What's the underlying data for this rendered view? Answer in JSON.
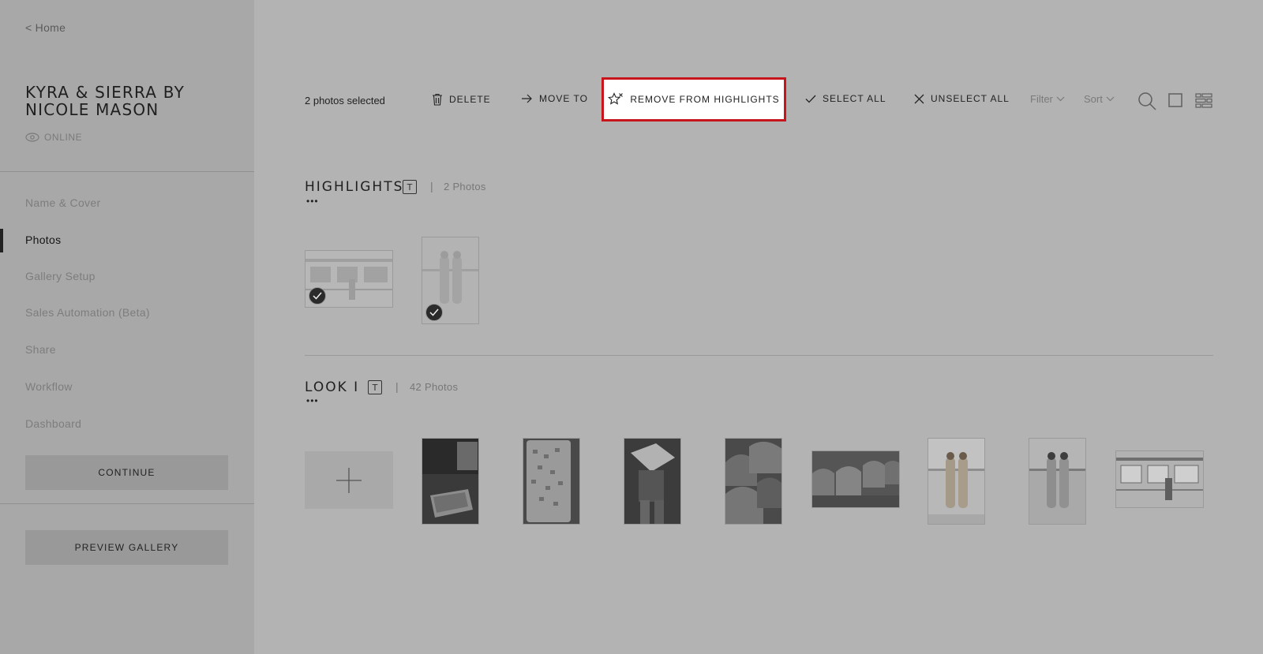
{
  "sidebar": {
    "home_link": "< Home",
    "gallery_title": "KYRA & SIERRA BY NICOLE MASON",
    "status": "ONLINE",
    "nav": [
      {
        "label": "Name & Cover"
      },
      {
        "label": "Photos"
      },
      {
        "label": "Gallery Setup"
      },
      {
        "label": "Sales Automation (Beta)"
      },
      {
        "label": "Share"
      },
      {
        "label": "Workflow"
      },
      {
        "label": "Dashboard"
      }
    ],
    "active_nav": "Photos",
    "continue_label": "CONTINUE",
    "preview_label": "PREVIEW GALLERY"
  },
  "toolbar": {
    "selected_text": "2 photos selected",
    "delete_label": "DELETE",
    "move_label": "MOVE TO",
    "remove_highlights_label": "REMOVE FROM HIGHLIGHTS",
    "select_all_label": "SELECT ALL",
    "unselect_all_label": "UNSELECT ALL",
    "filter_label": "Filter",
    "sort_label": "Sort",
    "highlight_border_color": "#c8141b"
  },
  "sections": {
    "highlights": {
      "title": "HIGHLIGHTS",
      "dots": "•••",
      "t_icon": "T",
      "separator": "|",
      "count": "2 Photos"
    },
    "look1": {
      "title": "LOOK I",
      "dots": "•••",
      "t_icon": "T",
      "separator": "|",
      "count": "42 Photos"
    }
  }
}
